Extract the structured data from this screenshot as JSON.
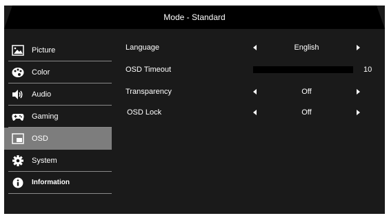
{
  "title": "Mode - Standard",
  "sidebar": {
    "items": [
      {
        "label": "Picture",
        "icon": "picture-icon"
      },
      {
        "label": "Color",
        "icon": "palette-icon"
      },
      {
        "label": "Audio",
        "icon": "speaker-icon"
      },
      {
        "label": "Gaming",
        "icon": "gamepad-icon"
      },
      {
        "label": "OSD",
        "icon": "osd-icon",
        "selected": true
      },
      {
        "label": "System",
        "icon": "gear-icon"
      },
      {
        "label": "Information",
        "icon": "info-icon"
      }
    ]
  },
  "settings": {
    "language": {
      "label": "Language",
      "value": "English"
    },
    "osd_timeout": {
      "label": "OSD Timeout",
      "value": "10",
      "level": 10
    },
    "transparency": {
      "label": "Transparency",
      "value": "Off"
    },
    "osd_lock": {
      "label": "OSD Lock",
      "value": "Off"
    }
  },
  "colors": {
    "panel_background": "#1a1a1a",
    "header_background": "#000000",
    "selected_item": "#7d7d7d",
    "text": "#ffffff"
  }
}
